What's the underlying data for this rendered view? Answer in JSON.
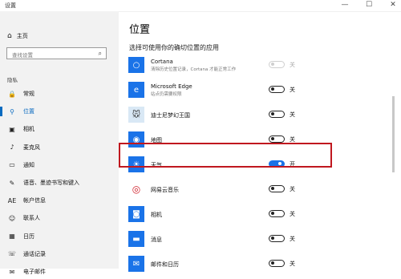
{
  "window": {
    "title": "设置",
    "min": "—",
    "max": "☐",
    "close": "✕"
  },
  "sidebar": {
    "home": {
      "label": "主页",
      "icon": "home-icon"
    },
    "search_placeholder": "查找设置",
    "section": "隐私",
    "items": [
      {
        "label": "常规",
        "icon": "lock-icon",
        "glyph": "🔒"
      },
      {
        "label": "位置",
        "icon": "location-icon",
        "glyph": "⚲"
      },
      {
        "label": "相机",
        "icon": "camera-icon",
        "glyph": "▣"
      },
      {
        "label": "麦克风",
        "icon": "microphone-icon",
        "glyph": "♪"
      },
      {
        "label": "通知",
        "icon": "notification-icon",
        "glyph": "▭"
      },
      {
        "label": "语音、墨迹书写和键入",
        "icon": "ink-icon",
        "glyph": "✎"
      },
      {
        "label": "帐户信息",
        "icon": "account-icon",
        "glyph": "AE"
      },
      {
        "label": "联系人",
        "icon": "contacts-icon",
        "glyph": "☺"
      },
      {
        "label": "日历",
        "icon": "calendar-icon",
        "glyph": "▦"
      },
      {
        "label": "通话记录",
        "icon": "call-history-icon",
        "glyph": "☏"
      },
      {
        "label": "电子邮件",
        "icon": "email-icon",
        "glyph": "✉"
      }
    ],
    "active_index": 1
  },
  "main": {
    "title": "位置",
    "subtitle": "选择可使用你的确切位置的应用",
    "apps": [
      {
        "name": "Cortana",
        "desc": "清除历史位置记录，Cortana 才能正常工作",
        "state": "关",
        "on": false,
        "disabled": true,
        "icon": "cortana-icon",
        "color": "#1a73e8",
        "glyph": "○"
      },
      {
        "name": "Microsoft Edge",
        "desc": "站点仍需要权限",
        "state": "关",
        "on": false,
        "disabled": false,
        "icon": "edge-icon",
        "color": "#1a73e8",
        "glyph": "e"
      },
      {
        "name": "迪士尼梦幻王国",
        "desc": "",
        "state": "关",
        "on": false,
        "disabled": false,
        "icon": "disney-icon",
        "color": "#d9e8f5",
        "glyph": "🐭"
      },
      {
        "name": "地图",
        "desc": "",
        "state": "关",
        "on": false,
        "disabled": false,
        "icon": "maps-icon",
        "color": "#1a73e8",
        "glyph": "◉"
      },
      {
        "name": "天气",
        "desc": "",
        "state": "开",
        "on": true,
        "disabled": false,
        "icon": "weather-icon",
        "color": "#1a73e8",
        "glyph": "☀"
      },
      {
        "name": "网易云音乐",
        "desc": "",
        "state": "关",
        "on": false,
        "disabled": false,
        "icon": "netease-music-icon",
        "color": "#ffffff",
        "glyph": "◎"
      },
      {
        "name": "相机",
        "desc": "",
        "state": "关",
        "on": false,
        "disabled": false,
        "icon": "camera-app-icon",
        "color": "#1a73e8",
        "glyph": "◙"
      },
      {
        "name": "消息",
        "desc": "",
        "state": "关",
        "on": false,
        "disabled": false,
        "icon": "messaging-icon",
        "color": "#1a73e8",
        "glyph": "▬"
      },
      {
        "name": "邮件和日历",
        "desc": "",
        "state": "关",
        "on": false,
        "disabled": false,
        "icon": "mail-calendar-icon",
        "color": "#1a73e8",
        "glyph": "✉"
      }
    ]
  },
  "colors": {
    "accent": "#1a73e8",
    "highlight_box": "#c0181f"
  }
}
